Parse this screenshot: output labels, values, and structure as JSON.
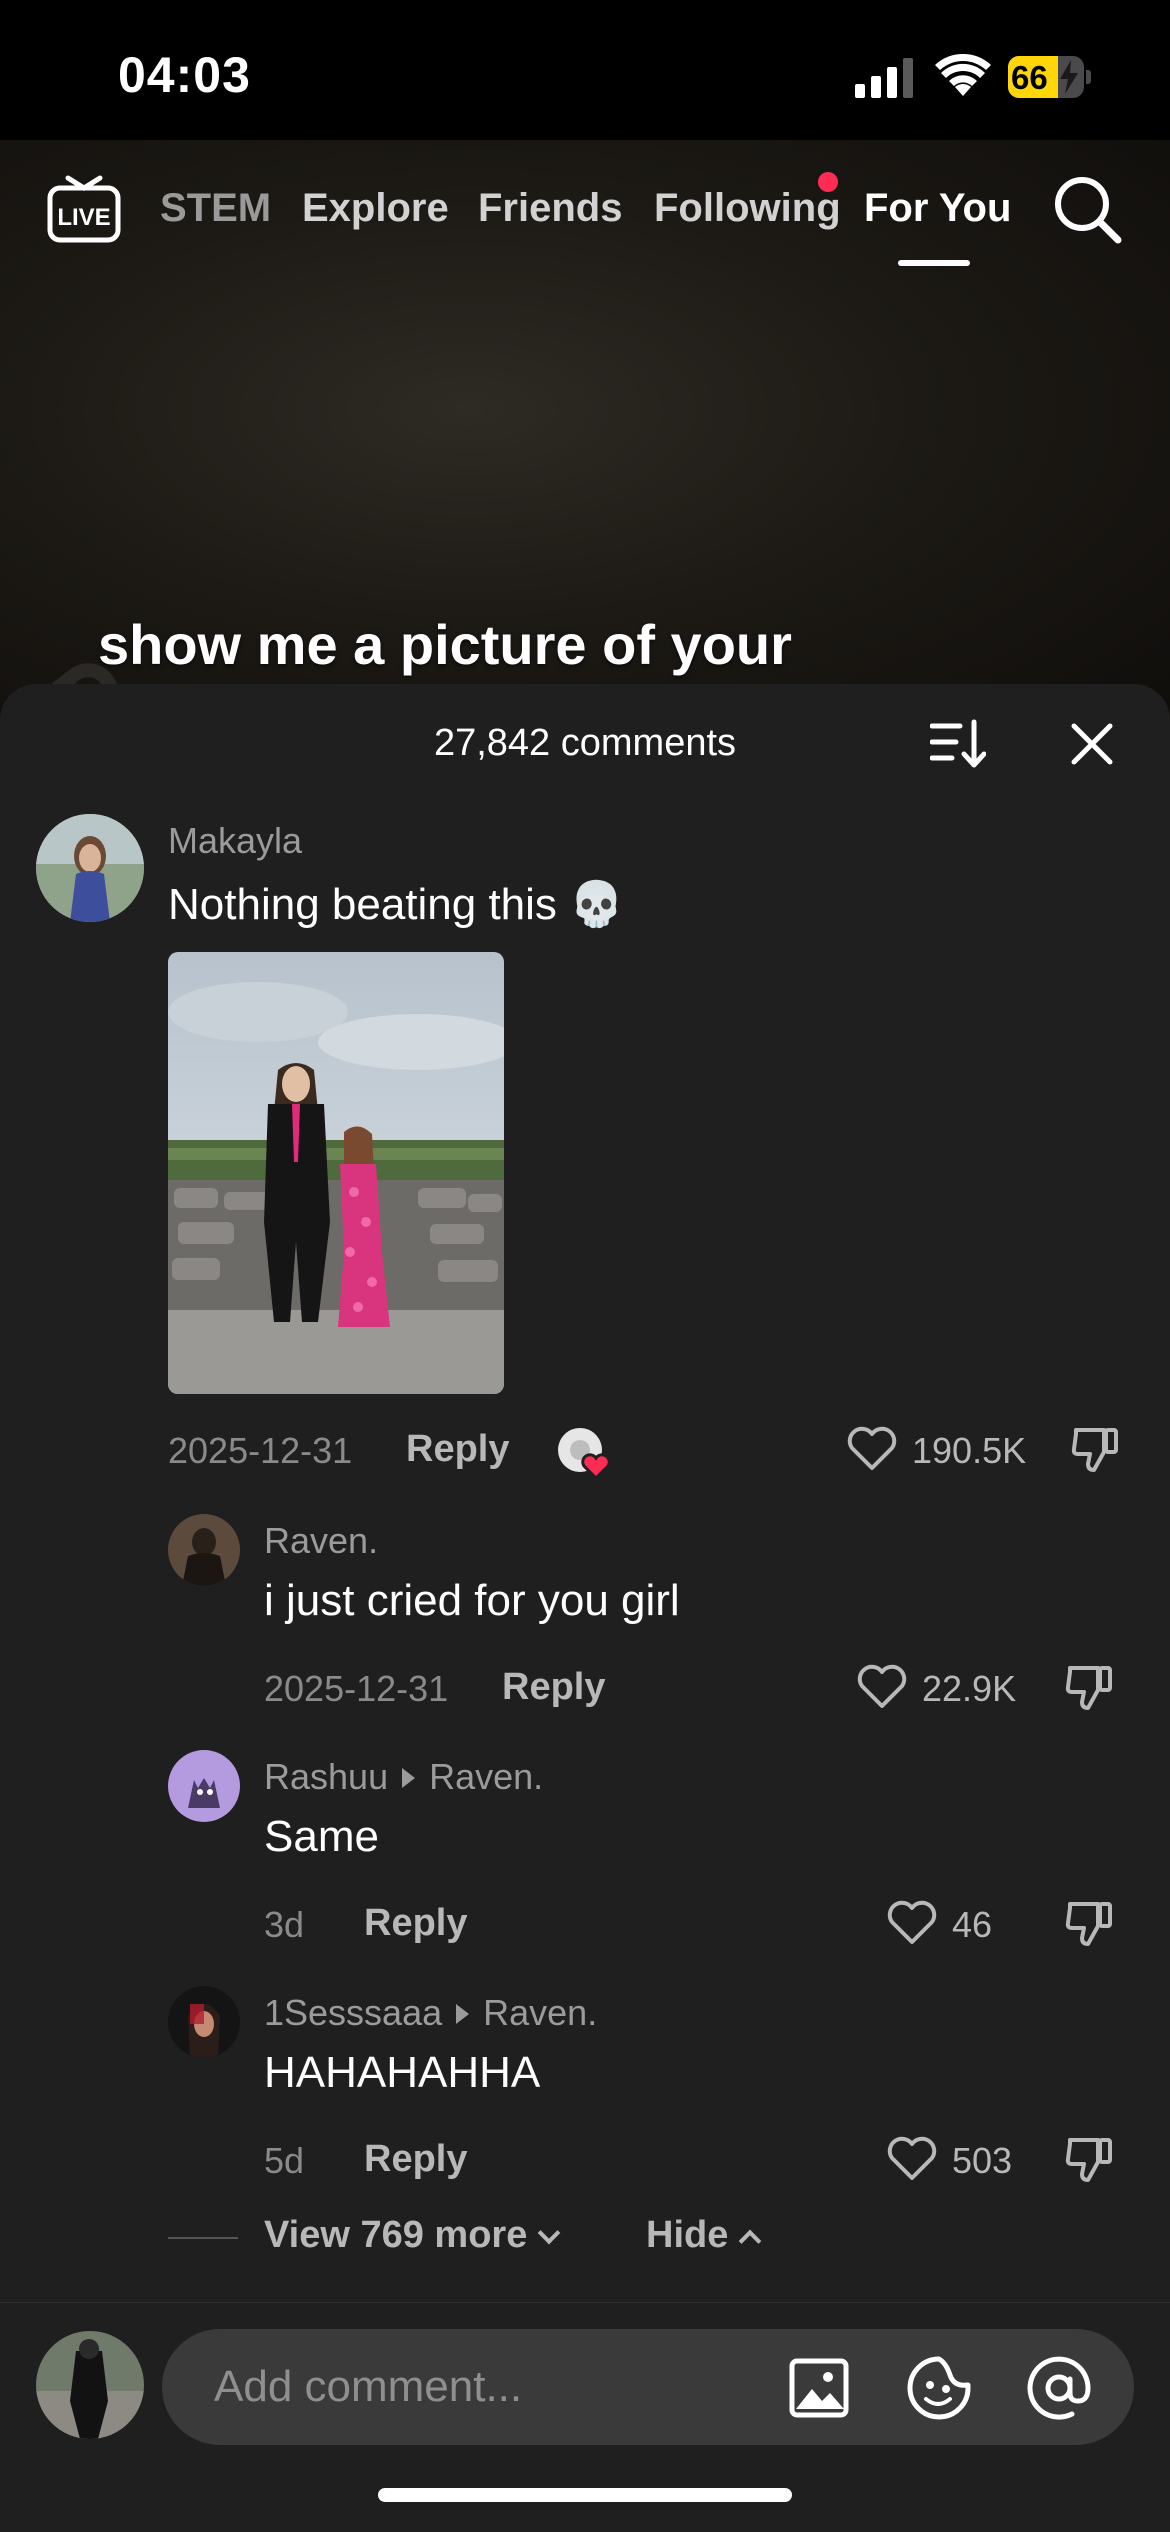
{
  "status_bar": {
    "time": "04:03",
    "battery_percent": "66",
    "battery_level": 0.66
  },
  "nav": {
    "tabs": [
      {
        "label": "STEM"
      },
      {
        "label": "Explore"
      },
      {
        "label": "Friends"
      },
      {
        "label": "Following",
        "has_dot": true
      },
      {
        "label": "For You",
        "active": true
      }
    ],
    "live_label": "LIVE"
  },
  "video": {
    "caption": "show me a picture of your"
  },
  "comments_sheet": {
    "title": "27,842 comments",
    "comments": [
      {
        "username": "Makayla",
        "text": "Nothing beating this 💀",
        "has_photo": true,
        "date": "2025-12-31",
        "reply_label": "Reply",
        "likes": "190.5K",
        "creator_liked": true
      },
      {
        "username": "Raven.",
        "text": "i just cried for you girl",
        "date": "2025-12-31",
        "reply_label": "Reply",
        "likes": "22.9K"
      },
      {
        "username": "Rashuu",
        "reply_to": "Raven.",
        "text": "Same",
        "date": "3d",
        "reply_label": "Reply",
        "likes": "46"
      },
      {
        "username": "1Sesssaaa",
        "reply_to": "Raven.",
        "text": "HAHAHAHHA",
        "date": "5d",
        "reply_label": "Reply",
        "likes": "503"
      }
    ],
    "view_more_label": "View 769 more",
    "hide_label": "Hide"
  },
  "composer": {
    "placeholder": "Add comment..."
  },
  "colors": {
    "accent": "#fe2c55",
    "sheet_bg": "#1f1f1f",
    "battery": "#ffd60a"
  }
}
